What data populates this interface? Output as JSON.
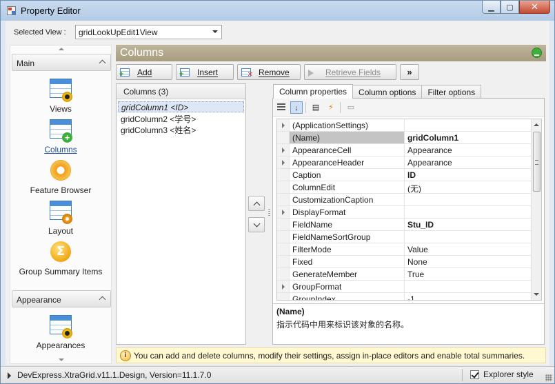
{
  "window": {
    "title": "Property Editor"
  },
  "selected_view": {
    "label": "Selected View :",
    "value": "gridLookUpEdit1View"
  },
  "nav": {
    "groups": [
      {
        "label": "Main"
      },
      {
        "label": "Appearance"
      }
    ],
    "items": [
      {
        "label": "Views",
        "icon": "views-icon"
      },
      {
        "label": "Columns",
        "icon": "columns-icon",
        "selected": true
      },
      {
        "label": "Feature Browser",
        "icon": "feature-browser-icon"
      },
      {
        "label": "Layout",
        "icon": "layout-icon"
      },
      {
        "label": "Group Summary Items",
        "icon": "sigma-icon"
      },
      {
        "label": "Appearances",
        "icon": "appearances-icon"
      }
    ]
  },
  "panel": {
    "title": "Columns"
  },
  "toolbar": {
    "add": "Add",
    "insert": "Insert",
    "remove": "Remove",
    "retrieve_fields": "Retrieve Fields",
    "more": "»"
  },
  "columns_list": {
    "header": "Columns (3)",
    "items": [
      "gridColumn1 <ID>",
      "gridColumn2 <学号>",
      "gridColumn3 <姓名>"
    ]
  },
  "tabs": [
    {
      "label": "Column properties",
      "active": true
    },
    {
      "label": "Column options",
      "active": false
    },
    {
      "label": "Filter options",
      "active": false
    }
  ],
  "properties": [
    {
      "name": "(ApplicationSettings)",
      "value": "",
      "expandable": true
    },
    {
      "name": "(Name)",
      "value": "gridColumn1",
      "bold": true,
      "selected": true
    },
    {
      "name": "AppearanceCell",
      "value": "Appearance",
      "expandable": true
    },
    {
      "name": "AppearanceHeader",
      "value": "Appearance",
      "expandable": true
    },
    {
      "name": "Caption",
      "value": "ID",
      "bold": true
    },
    {
      "name": "ColumnEdit",
      "value": "(无)"
    },
    {
      "name": "CustomizationCaption",
      "value": ""
    },
    {
      "name": "DisplayFormat",
      "value": "",
      "expandable": true
    },
    {
      "name": "FieldName",
      "value": "Stu_ID",
      "bold": true
    },
    {
      "name": "FieldNameSortGroup",
      "value": ""
    },
    {
      "name": "FilterMode",
      "value": "Value"
    },
    {
      "name": "Fixed",
      "value": "None"
    },
    {
      "name": "GenerateMember",
      "value": "True"
    },
    {
      "name": "GroupFormat",
      "value": "",
      "expandable": true
    },
    {
      "name": "GroupIndex",
      "value": "-1"
    }
  ],
  "description": {
    "title": "(Name)",
    "text": "指示代码中用来标识该对象的名称。"
  },
  "hint": {
    "text": "You can add and delete columns, modify their settings, assign in-place editors and enable total summaries."
  },
  "status": {
    "text": "DevExpress.XtraGrid.v11.1.Design, Version=11.1.7.0",
    "explorer_style_label": "Explorer style",
    "explorer_style_checked": true
  }
}
